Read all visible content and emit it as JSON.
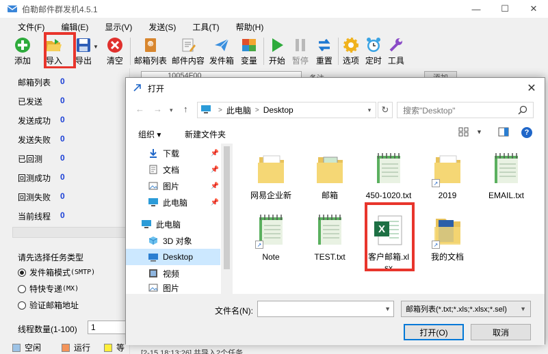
{
  "app": {
    "title": "伯勒邮件群发机4.5.1",
    "window_controls": [
      "—",
      "☐",
      "✕"
    ]
  },
  "menu": [
    "文件(F)",
    "编辑(E)",
    "显示(V)",
    "发送(S)",
    "工具(T)",
    "帮助(H)"
  ],
  "toolbar": {
    "add": "添加",
    "import": "导入",
    "export": "导出",
    "clear": "清空",
    "mailbox_list": "邮箱列表",
    "mail_content": "邮件内容",
    "outbox": "发件箱",
    "variables": "变量",
    "start": "开始",
    "pause": "暂停",
    "reset": "重置",
    "options": "选项",
    "timer": "定时",
    "tools": "工具"
  },
  "stats": [
    {
      "label": "邮箱列表",
      "value": "0"
    },
    {
      "label": "已发送",
      "value": "0"
    },
    {
      "label": "发送成功",
      "value": "0"
    },
    {
      "label": "发送失败",
      "value": "0"
    },
    {
      "label": "已回测",
      "value": "0"
    },
    {
      "label": "回测成功",
      "value": "0"
    },
    {
      "label": "回测失败",
      "value": "0"
    },
    {
      "label": "当前线程",
      "value": "0"
    }
  ],
  "task": {
    "title": "请先选择任务类型",
    "options": [
      {
        "label": "发件箱模式",
        "code": "(SMTP)",
        "selected": true
      },
      {
        "label": "特快专递",
        "code": "(MX)",
        "selected": false
      },
      {
        "label": "验证邮箱地址",
        "code": "",
        "selected": false
      }
    ]
  },
  "threads": {
    "label": "线程数量(1-100)",
    "value": "1"
  },
  "legend": [
    {
      "label": "空闲",
      "color": "#9dc3e6"
    },
    {
      "label": "运行",
      "color": "#f4945a"
    },
    {
      "label": "等",
      "color": "#ffef3a"
    }
  ],
  "background": {
    "field1": "10054F00",
    "field2": "备注",
    "field3": "添加",
    "log": "[2-15 18:13:26] 共导入2个任务..."
  },
  "dialog": {
    "title": "打开",
    "breadcrumb": [
      "此电脑",
      "Desktop"
    ],
    "search_placeholder": "搜索\"Desktop\"",
    "organize": "组织 ▾",
    "new_folder": "新建文件夹",
    "nav": [
      {
        "label": "下载",
        "icon": "download-icon",
        "pinned": true
      },
      {
        "label": "文档",
        "icon": "document-icon",
        "pinned": true
      },
      {
        "label": "图片",
        "icon": "picture-icon",
        "pinned": true
      },
      {
        "label": "此电脑",
        "icon": "computer-icon",
        "pinned": true
      },
      {
        "label": "此电脑",
        "icon": "computer-icon",
        "pinned": false
      },
      {
        "label": "3D 对象",
        "icon": "cube-icon",
        "pinned": false
      },
      {
        "label": "Desktop",
        "icon": "desktop-icon",
        "pinned": false
      },
      {
        "label": "视频",
        "icon": "video-icon",
        "pinned": false
      },
      {
        "label": "图片",
        "icon": "picture-icon",
        "pinned": false
      }
    ],
    "files": [
      {
        "name": "网易企业新",
        "type": "folder"
      },
      {
        "name": "邮箱",
        "type": "folder"
      },
      {
        "name": "450-1020.txt",
        "type": "notepad"
      },
      {
        "name": "2019",
        "type": "folder-shortcut"
      },
      {
        "name": "EMAIL.txt",
        "type": "notepad"
      },
      {
        "name": "Note",
        "type": "notepad-shortcut"
      },
      {
        "name": "TEST.txt",
        "type": "notepad"
      },
      {
        "name": "客户邮箱.xlsx",
        "type": "excel"
      },
      {
        "name": "我的文档",
        "type": "docs-shortcut"
      }
    ],
    "filename_label": "文件名(N):",
    "filename_value": "",
    "filter": "邮箱列表(*.txt;*.xls;*.xlsx;*.sel)",
    "open_button": "打开(O)",
    "cancel_button": "取消"
  },
  "colors": {
    "highlight": "#e8352c",
    "stat_value": "#1a3fd6",
    "selection": "#cce8ff",
    "accent": "#0078d7"
  }
}
